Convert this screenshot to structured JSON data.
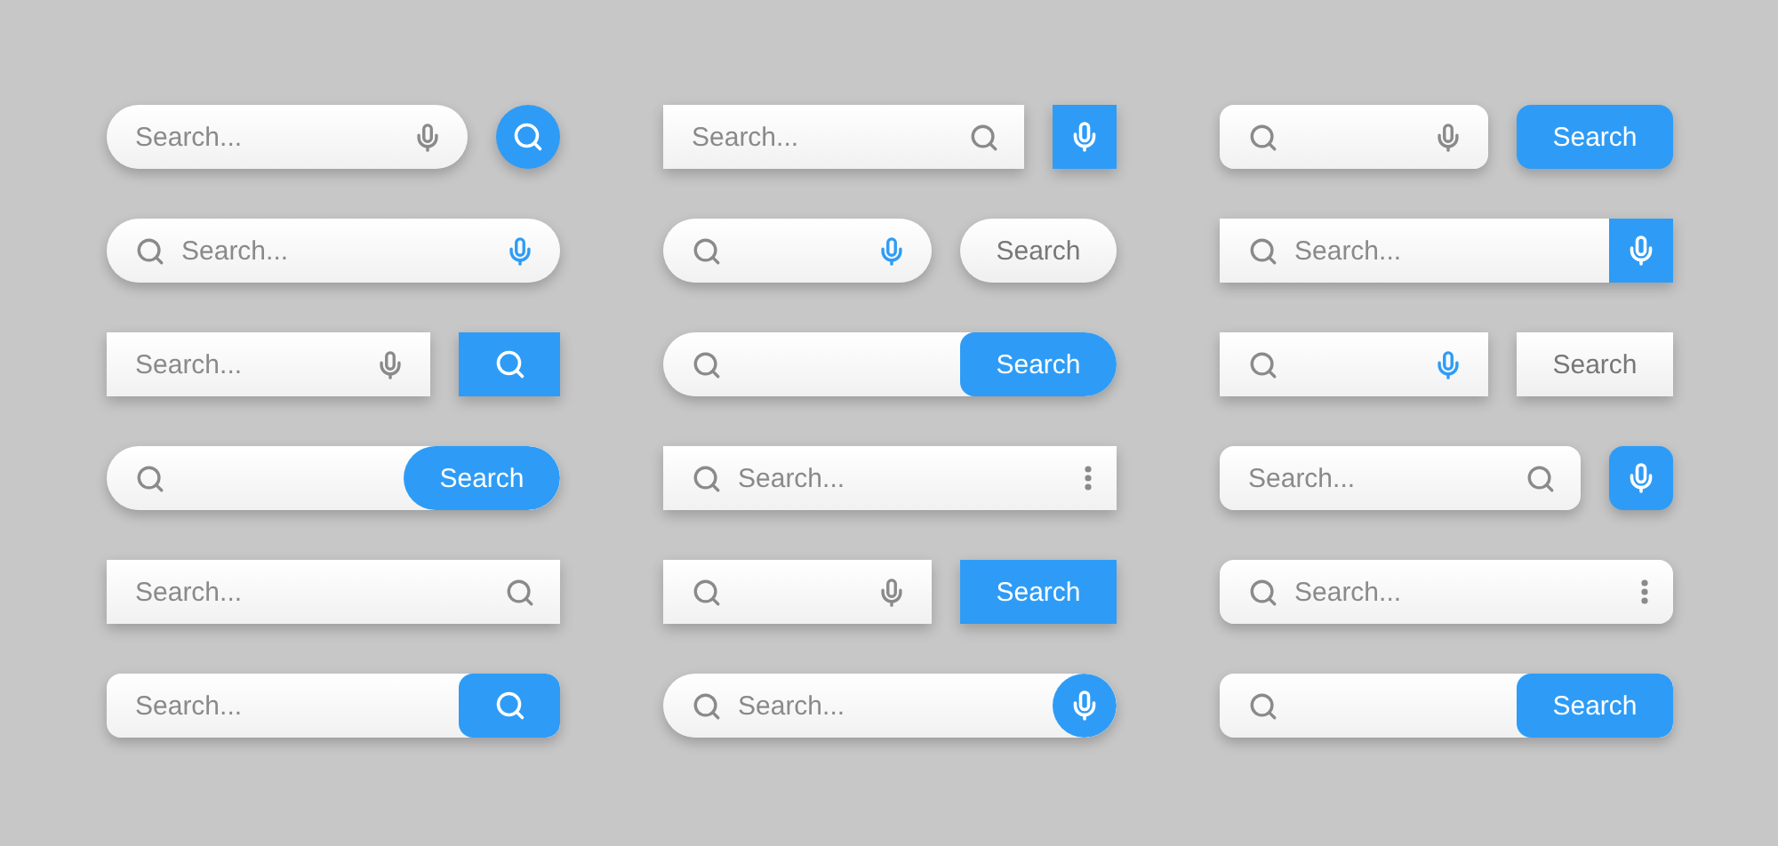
{
  "columns": [
    {
      "bars": [
        {
          "kind": "pill",
          "search_icon": false,
          "placeholder": "Search...",
          "inner_icon": {
            "kind": "mic",
            "blue": false
          },
          "button": {
            "kind": "search",
            "attached": false,
            "frame": {
              "kind": "circle"
            },
            "blue": true
          }
        },
        {
          "kind": "pill",
          "search_icon": true,
          "placeholder": "Search...",
          "inner_icon": {
            "kind": "mic",
            "blue": true
          }
        },
        {
          "kind": "square",
          "search_icon": false,
          "placeholder": "Search...",
          "inner_icon": {
            "kind": "mic",
            "blue": false
          },
          "button": {
            "kind": "search",
            "attached": false,
            "frame": {
              "kind": "square"
            },
            "blue": true
          }
        },
        {
          "kind": "pill",
          "search_icon": true,
          "button": {
            "kind": "text",
            "label": "Search",
            "attached": true,
            "frame": {
              "kind": "pill"
            },
            "blue": true
          }
        },
        {
          "kind": "square",
          "search_icon": false,
          "placeholder": "Search...",
          "inner_icon": {
            "kind": "search",
            "blue": false
          }
        },
        {
          "kind": "rounded",
          "search_icon": false,
          "placeholder": "Search...",
          "button": {
            "kind": "search",
            "attached": true,
            "frame": {
              "kind": "rounded"
            },
            "blue": true
          }
        }
      ]
    },
    {
      "bars": [
        {
          "kind": "square",
          "search_icon": false,
          "placeholder": "Search...",
          "inner_icon": {
            "kind": "search",
            "blue": false
          },
          "button": {
            "kind": "mic",
            "attached": false,
            "frame": {
              "kind": "square"
            },
            "blue": true
          }
        },
        {
          "kind": "pill",
          "search_icon": true,
          "inner_icon": {
            "kind": "mic",
            "blue": true
          },
          "button": {
            "kind": "text",
            "label": "Search",
            "attached": false,
            "frame": {
              "kind": "pill"
            },
            "blue": false
          }
        },
        {
          "kind": "pill",
          "search_icon": true,
          "button": {
            "kind": "text",
            "label": "Search",
            "attached": true,
            "frame": {
              "kind": "rounded"
            },
            "blue": true
          }
        },
        {
          "kind": "square",
          "search_icon": true,
          "placeholder": "Search...",
          "inner_icon": {
            "kind": "dots",
            "blue": false
          }
        },
        {
          "kind": "square",
          "search_icon": true,
          "inner_icon": {
            "kind": "mic",
            "blue": false
          },
          "button": {
            "kind": "text",
            "label": "Search",
            "attached": false,
            "frame": {
              "kind": "square"
            },
            "blue": true
          }
        },
        {
          "kind": "pill",
          "search_icon": true,
          "placeholder": "Search...",
          "button": {
            "kind": "mic",
            "attached": true,
            "frame": {
              "kind": "circle"
            },
            "blue": true
          }
        }
      ]
    },
    {
      "bars": [
        {
          "kind": "rounded",
          "search_icon": true,
          "inner_icon": {
            "kind": "mic",
            "blue": false
          },
          "button": {
            "kind": "text",
            "label": "Search",
            "attached": false,
            "frame": {
              "kind": "rounded"
            },
            "blue": true
          }
        },
        {
          "kind": "square",
          "search_icon": true,
          "placeholder": "Search...",
          "button": {
            "kind": "mic",
            "attached": true,
            "frame": {
              "kind": "square"
            },
            "blue": true
          }
        },
        {
          "kind": "square",
          "search_icon": true,
          "inner_icon": {
            "kind": "mic",
            "blue": true
          },
          "button": {
            "kind": "text",
            "label": "Search",
            "attached": false,
            "frame": {
              "kind": "square"
            },
            "blue": false
          }
        },
        {
          "kind": "rounded",
          "search_icon": false,
          "placeholder": "Search...",
          "inner_icon": {
            "kind": "search",
            "blue": false
          },
          "button": {
            "kind": "mic",
            "attached": false,
            "frame": {
              "kind": "rounded"
            },
            "blue": true
          }
        },
        {
          "kind": "rounded",
          "search_icon": true,
          "placeholder": "Search...",
          "inner_icon": {
            "kind": "dots",
            "blue": false
          }
        },
        {
          "kind": "rounded",
          "search_icon": true,
          "button": {
            "kind": "text",
            "label": "Search",
            "attached": true,
            "frame": {
              "kind": "rounded"
            },
            "blue": true
          }
        }
      ]
    }
  ]
}
